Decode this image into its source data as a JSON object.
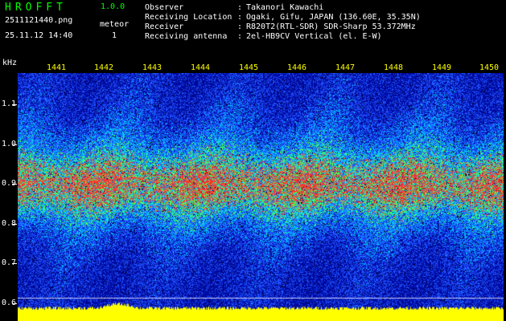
{
  "header": {
    "app_title": "HROFFT",
    "app_version": "1.0.0",
    "file_name": "2511121440.png",
    "timestamp": "25.11.12 14:40",
    "meteor_label": "meteor",
    "meteor_count": "1"
  },
  "station_info": [
    {
      "label": "Observer",
      "separator": ":",
      "value": "Takanori Kawachi"
    },
    {
      "label": "Receiving Location",
      "separator": ":",
      "value": "Ogaki, Gifu, JAPAN (136.60E, 35.35N)"
    },
    {
      "label": "Receiver",
      "separator": ":",
      "value": "R820T2(RTL-SDR) SDR-Sharp 53.372MHz"
    },
    {
      "label": "Receiving antenna",
      "separator": ":",
      "value": "2el-HB9CV Vertical (el. E-W)"
    }
  ],
  "axes": {
    "frequency_unit": "kHz",
    "frequency_ticks": [
      "1.1",
      "1.0",
      "0.9",
      "0.8",
      "0.7",
      "0.6"
    ],
    "time_ticks": [
      "1441",
      "1442",
      "1443",
      "1444",
      "1445",
      "1446",
      "1447",
      "1448",
      "1449",
      "1450"
    ]
  },
  "colors": {
    "background": "#000000",
    "title_green": "#00ff00",
    "time_label_yellow": "#ffff00",
    "noise_floor_yellow": "#ffff00",
    "signal_deep_blue": "#000aa0",
    "signal_blue": "#1e50ff",
    "signal_cyan": "#00c8ff",
    "signal_green": "#50ff50",
    "signal_red": "#ff3030"
  }
}
